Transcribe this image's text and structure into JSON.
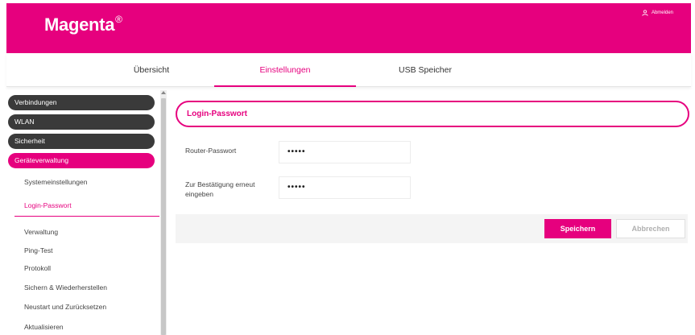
{
  "header": {
    "brand": "Magenta",
    "brand_mark": "®",
    "logout_label": "Abmelden",
    "logout_icon": "user-icon",
    "color": "#e6007e"
  },
  "tabs": [
    {
      "label": "Übersicht",
      "active": false
    },
    {
      "label": "Einstellungen",
      "active": true
    },
    {
      "label": "USB Speicher",
      "active": false
    }
  ],
  "sidebar": {
    "categories": [
      {
        "label": "Verbindungen",
        "active": false
      },
      {
        "label": "WLAN",
        "active": false
      },
      {
        "label": "Sicherheit",
        "active": false
      },
      {
        "label": "Geräteverwaltung",
        "active": true
      }
    ],
    "subitems": [
      {
        "label": "Systemeinstellungen",
        "active": false
      },
      {
        "label": "Login-Passwort",
        "active": true
      },
      {
        "label": "Verwaltung",
        "active": false
      },
      {
        "label": "Ping-Test",
        "active": false
      },
      {
        "label": "Protokoll",
        "active": false
      },
      {
        "label": "Sichern & Wiederherstellen",
        "active": false
      },
      {
        "label": "Neustart und Zurücksetzen",
        "active": false
      },
      {
        "label": "Aktualisieren",
        "active": false
      }
    ]
  },
  "form": {
    "title": "Login-Passwort",
    "fields": [
      {
        "label": "Router-Passwort",
        "value": "•••••"
      },
      {
        "label": "Zur Bestätigung erneut eingeben",
        "value": "•••••"
      }
    ],
    "save_label": "Speichern",
    "cancel_label": "Abbrechen"
  }
}
